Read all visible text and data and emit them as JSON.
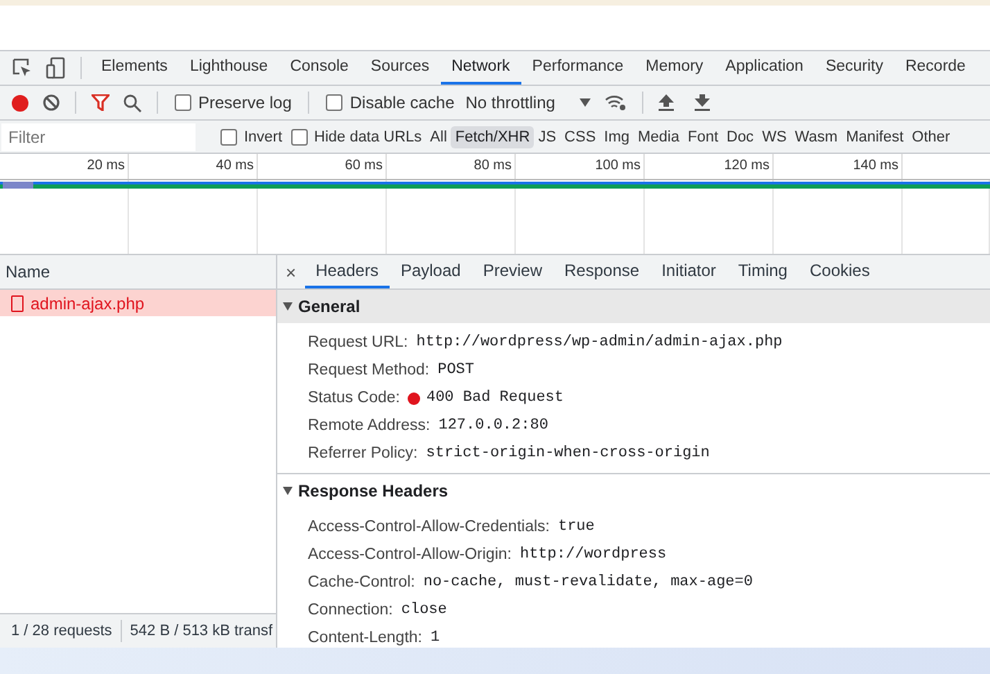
{
  "main_tabs": [
    {
      "label": "Elements",
      "selected": false
    },
    {
      "label": "Lighthouse",
      "selected": false
    },
    {
      "label": "Console",
      "selected": false
    },
    {
      "label": "Sources",
      "selected": false
    },
    {
      "label": "Network",
      "selected": true
    },
    {
      "label": "Performance",
      "selected": false
    },
    {
      "label": "Memory",
      "selected": false
    },
    {
      "label": "Application",
      "selected": false
    },
    {
      "label": "Security",
      "selected": false
    },
    {
      "label": "Recorde",
      "selected": false
    }
  ],
  "toolbar": {
    "recording": true,
    "preserve_log": {
      "label": "Preserve log",
      "checked": false
    },
    "disable_cache": {
      "label": "Disable cache",
      "checked": false
    },
    "throttling": "No throttling"
  },
  "filter_bar": {
    "placeholder": "Filter",
    "invert": {
      "label": "Invert",
      "checked": false
    },
    "hide_data_urls": {
      "label": "Hide data URLs",
      "checked": false
    },
    "types": [
      {
        "label": "All",
        "selected": false
      },
      {
        "label": "Fetch/XHR",
        "selected": true
      },
      {
        "label": "JS",
        "selected": false
      },
      {
        "label": "CSS",
        "selected": false
      },
      {
        "label": "Img",
        "selected": false
      },
      {
        "label": "Media",
        "selected": false
      },
      {
        "label": "Font",
        "selected": false
      },
      {
        "label": "Doc",
        "selected": false
      },
      {
        "label": "WS",
        "selected": false
      },
      {
        "label": "Wasm",
        "selected": false
      },
      {
        "label": "Manifest",
        "selected": false
      },
      {
        "label": "Other",
        "selected": false
      }
    ]
  },
  "timeline": {
    "ticks": [
      "20 ms",
      "40 ms",
      "60 ms",
      "80 ms",
      "100 ms",
      "120 ms",
      "140 ms"
    ]
  },
  "requests": {
    "column": "Name",
    "rows": [
      {
        "name": "admin-ajax.php",
        "selected": true,
        "error": true
      }
    ]
  },
  "status_bar": [
    "1 / 28 requests",
    "542 B / 513 kB transf"
  ],
  "details": {
    "close": "×",
    "tabs": [
      {
        "label": "Headers",
        "selected": true
      },
      {
        "label": "Payload",
        "selected": false
      },
      {
        "label": "Preview",
        "selected": false
      },
      {
        "label": "Response",
        "selected": false
      },
      {
        "label": "Initiator",
        "selected": false
      },
      {
        "label": "Timing",
        "selected": false
      },
      {
        "label": "Cookies",
        "selected": false
      }
    ],
    "sections": [
      {
        "title": "General",
        "expanded": true,
        "selected": true,
        "rows": [
          {
            "name": "Request URL:",
            "value": "http://wordpress/wp-admin/admin-ajax.php"
          },
          {
            "name": "Request Method:",
            "value": "POST"
          },
          {
            "name": "Status Code:",
            "value": "400 Bad Request",
            "color": "#e0141e"
          },
          {
            "name": "Remote Address:",
            "value": "127.0.0.2:80"
          },
          {
            "name": "Referrer Policy:",
            "value": "strict-origin-when-cross-origin"
          }
        ]
      },
      {
        "title": "Response Headers",
        "expanded": true,
        "selected": false,
        "rows": [
          {
            "name": "Access-Control-Allow-Credentials:",
            "value": "true"
          },
          {
            "name": "Access-Control-Allow-Origin:",
            "value": "http://wordpress"
          },
          {
            "name": "Cache-Control:",
            "value": "no-cache, must-revalidate, max-age=0"
          },
          {
            "name": "Connection:",
            "value": "close"
          },
          {
            "name": "Content-Length:",
            "value": "1"
          }
        ]
      }
    ]
  }
}
